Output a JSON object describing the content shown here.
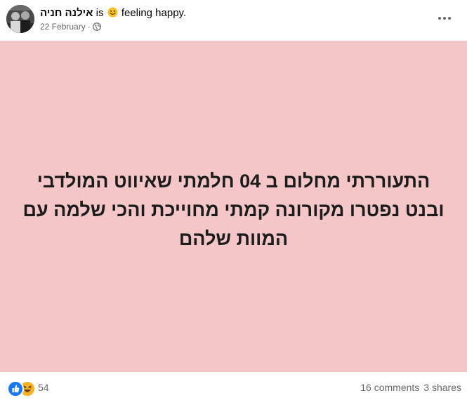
{
  "post": {
    "author": "אילנה חניה",
    "is_text": "is",
    "feeling_text": "feeling happy.",
    "feeling_emoji": "slightly-smiling-face",
    "date": "22 February",
    "separator": "·",
    "privacy_icon": "globe-icon",
    "more_icon": "three-dots-horizontal-icon"
  },
  "image": {
    "background_color": "#f4c6c7",
    "text_lines": [
      "התעוררתי מחלום ב 04 חלמתי שאיווט המולדבי",
      "ובנט נפטרו מקורונה קמתי מחוייכת והכי שלמה עם",
      "המוות שלהם"
    ]
  },
  "footer": {
    "reaction_icons": [
      "like-icon",
      "haha-icon"
    ],
    "reaction_count": "54",
    "comments": "16 comments",
    "shares": "3 shares"
  },
  "colors": {
    "meta_gray": "#65676b",
    "like_blue": "#1877f2",
    "haha_yellow": "#f7b125"
  }
}
